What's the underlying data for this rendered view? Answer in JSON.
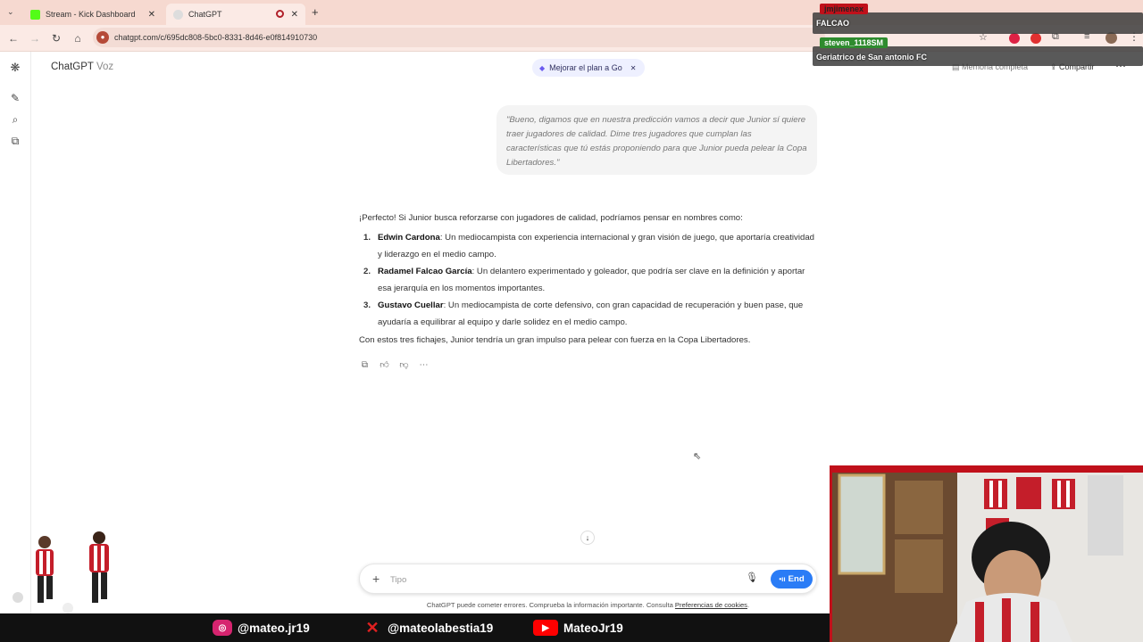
{
  "browser": {
    "tabs": [
      {
        "label": "Stream - Kick Dashboard",
        "active": false
      },
      {
        "label": "ChatGPT",
        "active": true
      }
    ],
    "url": "chatgpt.com/c/695dc808-5bc0-8331-8d46-e0f814910730"
  },
  "header": {
    "app_name": "ChatGPT",
    "mode": "Voz",
    "upgrade_label": "Mejorar el plan a Go",
    "memory_label": "Memoria completa",
    "share_label": "Compartir"
  },
  "overlay_chat": [
    {
      "user": "jmjimenex",
      "message": "FALCAO"
    },
    {
      "user": "steven_1118SM",
      "message": "Geriatrico de San antonio FC"
    }
  ],
  "conversation": {
    "user_message": "\"Bueno, digamos que en nuestra predicción vamos a decir que Junior sí quiere traer jugadores de calidad. Dime tres jugadores que cumplan las características que tú estás proponiendo para que Junior pueda pelear la Copa Libertadores.\"",
    "assistant": {
      "intro": "¡Perfecto! Si Junior busca reforzarse con jugadores de calidad, podríamos pensar en nombres como:",
      "items": [
        {
          "num": "1.",
          "name": "Edwin Cardona",
          "text": ": Un mediocampista con experiencia internacional y gran visión de juego, que aportaría creatividad y liderazgo en el medio campo."
        },
        {
          "num": "2.",
          "name": "Radamel Falcao García",
          "text": ": Un delantero experimentado y goleador, que podría ser clave en la definición y aportar esa jerarquía en los momentos importantes."
        },
        {
          "num": "3.",
          "name": "Gustavo Cuellar",
          "text": ": Un mediocampista de corte defensivo, con gran capacidad de recuperación y buen pase, que ayudaría a equilibrar al equipo y darle solidez en el medio campo."
        }
      ],
      "outro": "Con estos tres fichajes, Junior tendría un gran impulso para pelear con fuerza en la Copa Libertadores."
    }
  },
  "composer": {
    "placeholder": "Tipo",
    "end_label": "End"
  },
  "footer": {
    "disclaimer": "ChatGPT puede cometer errores. Comprueba la información importante. Consulta",
    "cookie_link": "Preferencias de cookies",
    "disclaimer_end": "."
  },
  "stream_socials": [
    {
      "network": "instagram-icon",
      "handle": "@mateo.jr19"
    },
    {
      "network": "x-icon",
      "handle": "@mateolabestia19"
    },
    {
      "network": "youtube-icon",
      "handle": "MateoJr19"
    }
  ],
  "colors": {
    "accent_blue": "#2a7cf6",
    "stream_red": "#c0101a",
    "tab_bar": "#f6d9d0"
  }
}
